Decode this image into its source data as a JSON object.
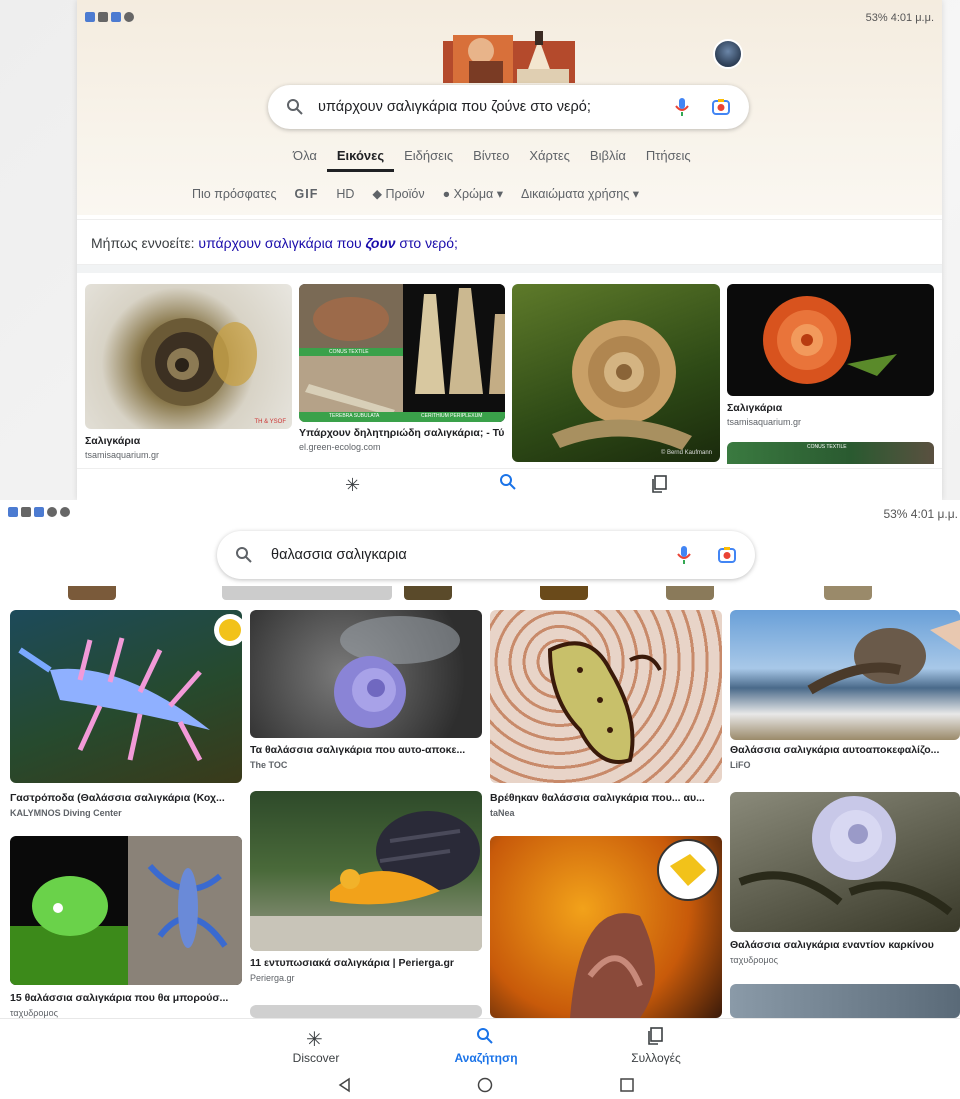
{
  "screen1": {
    "status_right": "53%  4:01 μ.μ.",
    "search_query": "υπάρχουν σαλιγκάρια που ζούνε στο νερό;",
    "tabs": [
      {
        "label": "Όλα"
      },
      {
        "label": "Εικόνες"
      },
      {
        "label": "Ειδήσεις"
      },
      {
        "label": "Βίντεο"
      },
      {
        "label": "Χάρτες"
      },
      {
        "label": "Βιβλία"
      },
      {
        "label": "Πτήσεις"
      }
    ],
    "filters": {
      "recent": "Πιο πρόσφατες",
      "gif": "GIF",
      "hd": "HD",
      "product": "Προϊόν",
      "color": "Χρώμα",
      "rights": "Δικαιώματα χρήσης"
    },
    "did_you_mean": {
      "prefix": "Μήπως εννοείτε:",
      "part1": "υπάρχουν σαλιγκάρια που",
      "bold": "ζουν",
      "part2": "στο νερό;"
    },
    "results": [
      {
        "title": "Σαλιγκάρια",
        "source": "tsamisaquarium.gr",
        "badge": "TH & YSOF"
      },
      {
        "title": "Υπάρχουν δηλητηριώδη σαλιγκάρια; - Τύ...",
        "source": "el.green-ecolog.com",
        "labels": [
          "CONUS TEXTILE",
          "TEREBRA SUBULATA",
          "CERITHIUM PERIPLEXUM"
        ]
      },
      {
        "title": "",
        "source": "",
        "badge": "© Bernd Kaufmann"
      },
      {
        "title": "Σαλιγκάρια",
        "source": "tsamisaquarium.gr"
      },
      {
        "title": "",
        "source": "",
        "labels": [
          "CONUS TEXTILE"
        ]
      }
    ]
  },
  "screen2": {
    "status_right": "53%  4:01 μ.μ.",
    "search_query": "θαλασσια σαλιγκαρια",
    "results": [
      {
        "title": "Γαστρόποδα (Θαλάσσια σαλιγκάρια (Κοχ...",
        "source": "KALYMNOS Diving Center"
      },
      {
        "title": "Τα θαλάσσια σαλιγκάρια που αυτο-αποκε...",
        "source": "The TOC"
      },
      {
        "title": "Βρέθηκαν θαλάσσια σαλιγκάρια που... αυ...",
        "source": "taNea"
      },
      {
        "title": "Θαλάσσια σαλιγκάρια αυτοαποκεφαλίζο...",
        "source": "LiFO"
      },
      {
        "title": "15 θαλάσσια σαλιγκάρια που θα μπορούσ...",
        "source": "ταχυδρομος"
      },
      {
        "title": "11 εντυπωσιακά σαλιγκάρια | Perierga.gr",
        "source": "Perierga.gr"
      },
      {
        "title": "",
        "source": ""
      },
      {
        "title": "Θαλάσσια σαλιγκάρια εναντίον καρκίνου",
        "source": "ταχυδρομος"
      }
    ],
    "bottom_nav": [
      {
        "label": "Discover",
        "icon": "asterisk-icon"
      },
      {
        "label": "Αναζήτηση",
        "icon": "search-icon"
      },
      {
        "label": "Συλλογές",
        "icon": "collections-icon"
      }
    ]
  },
  "colors": {
    "link": "#1a0dab",
    "active_nav": "#1a73e8",
    "mic": "#4285f4",
    "lens": "#fbbc04"
  }
}
